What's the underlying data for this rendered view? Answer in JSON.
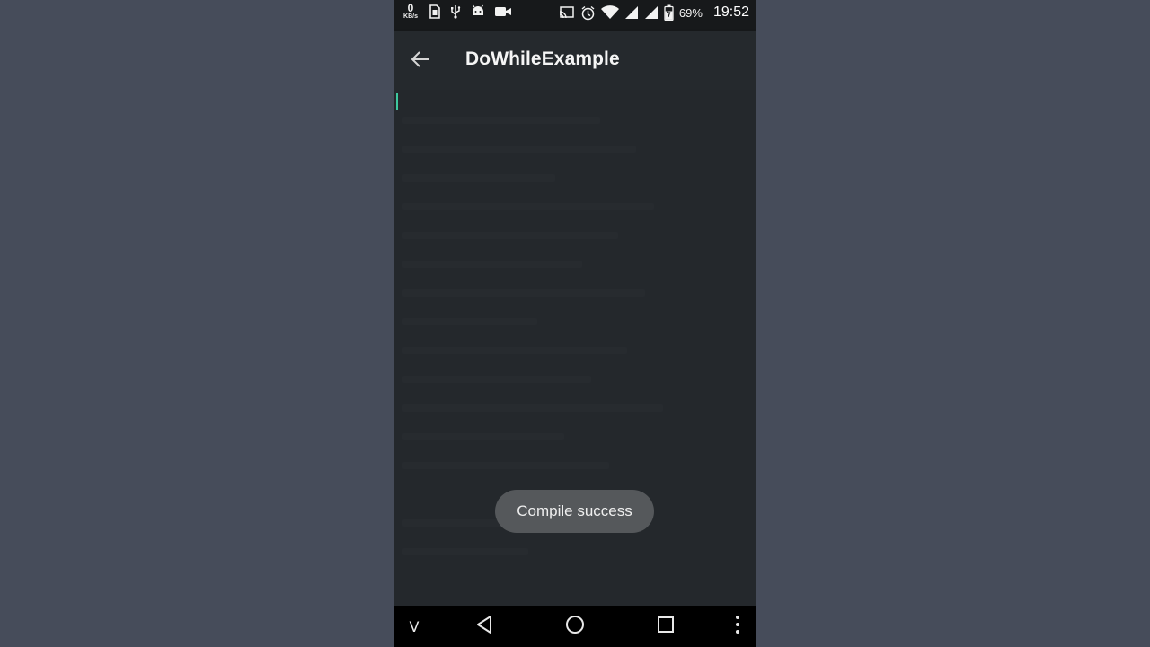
{
  "statusbar": {
    "net_speed_value": "0",
    "net_speed_unit": "KB/s",
    "icons_left": [
      "sim-card-icon",
      "usb-icon",
      "android-debug-icon",
      "video-camera-icon"
    ],
    "icons_right": [
      "cast-icon",
      "alarm-icon",
      "wifi-icon",
      "cell-signal-icon",
      "cell-signal-icon",
      "battery-charging-icon"
    ],
    "battery": "69%",
    "time": "19:52"
  },
  "toolbar": {
    "back_icon": "arrow-back-icon",
    "title": "DoWhileExample"
  },
  "editor": {
    "cursor_color": "#3ec8a0"
  },
  "toast": {
    "message": "Compile success"
  },
  "navbar": {
    "keyboard_hide_label": "V",
    "buttons": [
      "back-triangle-icon",
      "home-circle-icon",
      "recents-square-icon",
      "overflow-menu-icon"
    ]
  },
  "colors": {
    "outer_background": "#464c5a",
    "app_background": "#23272b",
    "statusbar": "#17191b",
    "toolbar": "#25292d",
    "toast": "#55585b"
  }
}
